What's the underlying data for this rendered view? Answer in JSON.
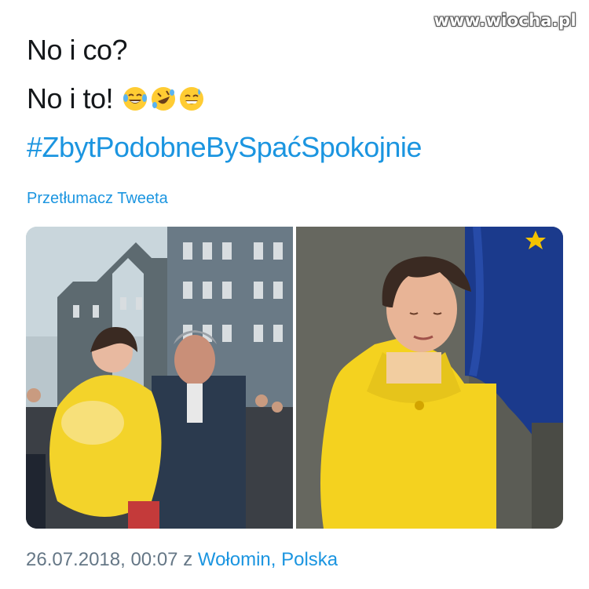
{
  "watermark": "www.wiocha.pl",
  "tweet": {
    "line1": "No i co?",
    "line2": "No i to!",
    "emojis": [
      "tears-of-joy-emoji",
      "rolling-on-floor-laughing-emoji",
      "grinning-sweat-emoji"
    ],
    "hashtag": "#ZbytPodobneBySpaćSpokojnie",
    "translate_label": "Przetłumacz Tweeta"
  },
  "media": {
    "left_photo": "photo-man-holding-child-in-yellow-coat",
    "right_photo": "photo-woman-in-yellow-jacket-eu-flag"
  },
  "footer": {
    "timestamp": "26.07.2018, 00:07",
    "connector": "z",
    "location": "Wołomin, Polska"
  },
  "colors": {
    "text": "#14171a",
    "link": "#1b95e0",
    "meta": "#657786",
    "yellow": "#f4d21f",
    "eu_blue": "#1b3a8c"
  }
}
